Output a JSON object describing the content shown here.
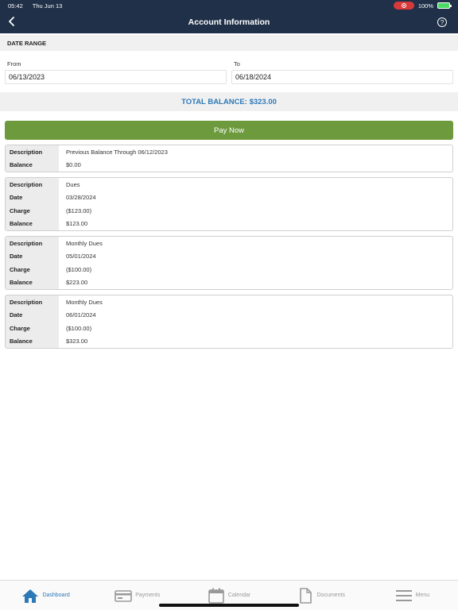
{
  "status": {
    "time": "05:42",
    "date": "Thu Jun 13",
    "battery": "100%"
  },
  "header": {
    "title": "Account Information",
    "help": "?"
  },
  "date_range": {
    "heading": "DATE RANGE",
    "from_label": "From",
    "from_value": "06/13/2023",
    "to_label": "To",
    "to_value": "06/18/2024"
  },
  "total_balance": "TOTAL BALANCE: $323.00",
  "pay_now": "Pay Now",
  "entries": [
    {
      "rows": [
        {
          "k": "Description",
          "v": "Previous Balance Through 06/12/2023"
        },
        {
          "k": "Balance",
          "v": "$0.00"
        }
      ]
    },
    {
      "rows": [
        {
          "k": "Description",
          "v": "Dues"
        },
        {
          "k": "Date",
          "v": "03/28/2024"
        },
        {
          "k": "Charge",
          "v": "($123.00)"
        },
        {
          "k": "Balance",
          "v": "$123.00"
        }
      ]
    },
    {
      "rows": [
        {
          "k": "Description",
          "v": "Monthly Dues"
        },
        {
          "k": "Date",
          "v": "05/01/2024"
        },
        {
          "k": "Charge",
          "v": "($100.00)"
        },
        {
          "k": "Balance",
          "v": "$223.00"
        }
      ]
    },
    {
      "rows": [
        {
          "k": "Description",
          "v": "Monthly Dues"
        },
        {
          "k": "Date",
          "v": "06/01/2024"
        },
        {
          "k": "Charge",
          "v": "($100.00)"
        },
        {
          "k": "Balance",
          "v": "$323.00"
        }
      ]
    }
  ],
  "tabs": [
    {
      "label": "Dashboard",
      "icon": "home-icon",
      "active": true
    },
    {
      "label": "Payments",
      "icon": "credit-card-icon",
      "active": false
    },
    {
      "label": "Calendar",
      "icon": "calendar-icon",
      "active": false
    },
    {
      "label": "Documents",
      "icon": "document-icon",
      "active": false
    },
    {
      "label": "Menu",
      "icon": "menu-icon",
      "active": false
    }
  ],
  "colors": {
    "header_bg": "#1f3048",
    "accent": "#2d79b8",
    "pay_green": "#6d9a3d"
  }
}
